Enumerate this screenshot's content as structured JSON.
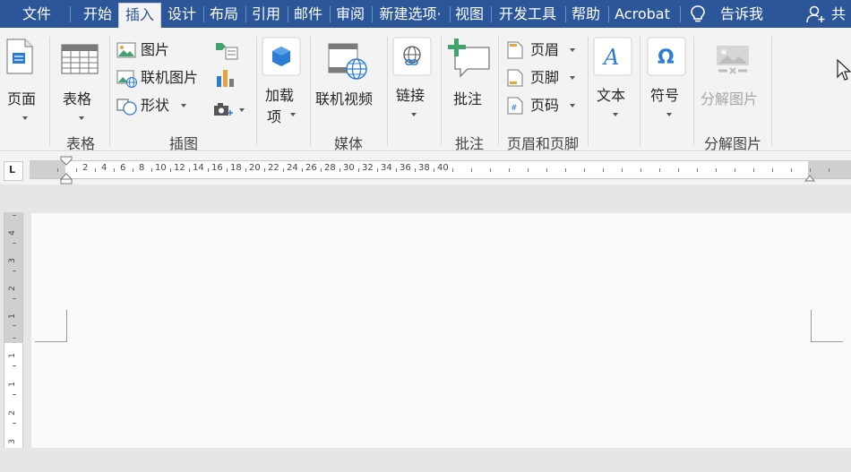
{
  "tabs": [
    {
      "label": "文件"
    },
    {
      "label": "开始"
    },
    {
      "label": "插入",
      "active": true
    },
    {
      "label": "设计"
    },
    {
      "label": "布局"
    },
    {
      "label": "引用"
    },
    {
      "label": "邮件"
    },
    {
      "label": "审阅"
    },
    {
      "label": "新建选项·"
    },
    {
      "label": "视图"
    },
    {
      "label": "开发工具"
    },
    {
      "label": "帮助"
    },
    {
      "label": "Acrobat"
    }
  ],
  "tell_me": {
    "label": "告诉我",
    "icon": "lightbulb-icon"
  },
  "share": {
    "label": "共",
    "icon": "person-add-icon"
  },
  "ribbon": {
    "pages": {
      "label": "页面"
    },
    "table": {
      "label": "表格",
      "group": "表格"
    },
    "illustrations": {
      "group": "插图",
      "picture": "图片",
      "online_picture": "联机图片",
      "shapes": "形状"
    },
    "addins": {
      "label_line1": "加载",
      "label_line2": "项"
    },
    "media": {
      "online_video": "联机视频",
      "group": "媒体"
    },
    "links": {
      "label": "链接"
    },
    "comments": {
      "label": "批注",
      "group": "批注"
    },
    "header_footer": {
      "header": "页眉",
      "footer": "页脚",
      "page_number": "页码",
      "group": "页眉和页脚"
    },
    "text": {
      "label": "文本"
    },
    "symbols": {
      "label": "符号",
      "glyph": "Ω"
    },
    "split_picture": {
      "label": "分解图片",
      "group": "分解图片"
    }
  },
  "ruler": {
    "numbers": [
      "2",
      "4",
      "6",
      "8",
      "10",
      "12",
      "14",
      "16",
      "18",
      "20",
      "22",
      "24",
      "26",
      "28",
      "30",
      "32",
      "34",
      "36",
      "38",
      "40"
    ],
    "tab_selector": "L"
  },
  "vertical_ruler": {
    "numbers": [
      "4",
      "3",
      "2",
      "1",
      "1",
      "1",
      "2",
      "3"
    ]
  },
  "colors": {
    "tab_bar": "#2b579a",
    "ribbon": "#f3f3f3",
    "accent_blue": "#2b7cd3",
    "accent_green": "#3fa36b"
  }
}
